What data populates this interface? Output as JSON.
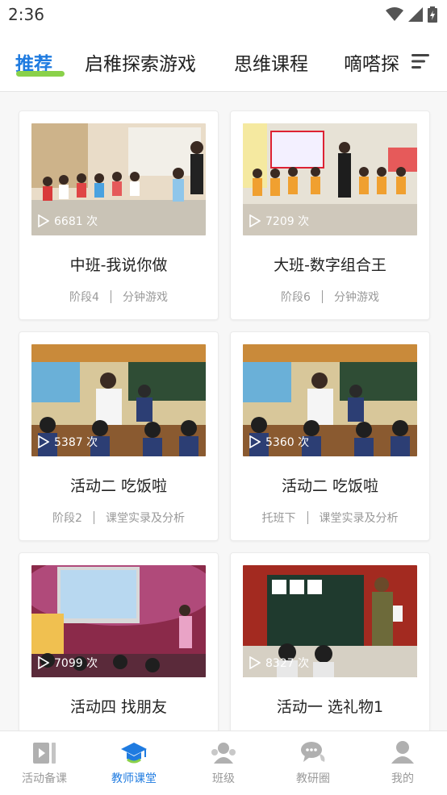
{
  "status": {
    "time": "2:36"
  },
  "tabs": [
    {
      "label": "推荐"
    },
    {
      "label": "启稚探索游戏"
    },
    {
      "label": "思维课程"
    },
    {
      "label": "嘀嗒探"
    }
  ],
  "cards": [
    {
      "plays": "6681 次",
      "title": "中班-我说你做",
      "stage": "阶段4",
      "category": "分钟游戏"
    },
    {
      "plays": "7209 次",
      "title": "大班-数字组合王",
      "stage": "阶段6",
      "category": "分钟游戏"
    },
    {
      "plays": "5387 次",
      "title": "活动二 吃饭啦",
      "stage": "阶段2",
      "category": "课堂实录及分析"
    },
    {
      "plays": "5360 次",
      "title": "活动二 吃饭啦",
      "stage": "托班下",
      "category": "课堂实录及分析"
    },
    {
      "plays": "7099 次",
      "title": "活动四 找朋友",
      "stage": "",
      "category": ""
    },
    {
      "plays": "8327 次",
      "title": "活动一 选礼物1",
      "stage": "",
      "category": ""
    }
  ],
  "nav": [
    {
      "label": "活动备课",
      "icon": "lesson-prep-icon"
    },
    {
      "label": "教师课堂",
      "icon": "teacher-classroom-icon"
    },
    {
      "label": "班级",
      "icon": "class-icon"
    },
    {
      "label": "教研圈",
      "icon": "discussion-icon"
    },
    {
      "label": "我的",
      "icon": "profile-icon"
    }
  ],
  "colors": {
    "accent": "#1f7be0",
    "underline": "#8ad14a",
    "inactive": "#9a9a9a"
  }
}
